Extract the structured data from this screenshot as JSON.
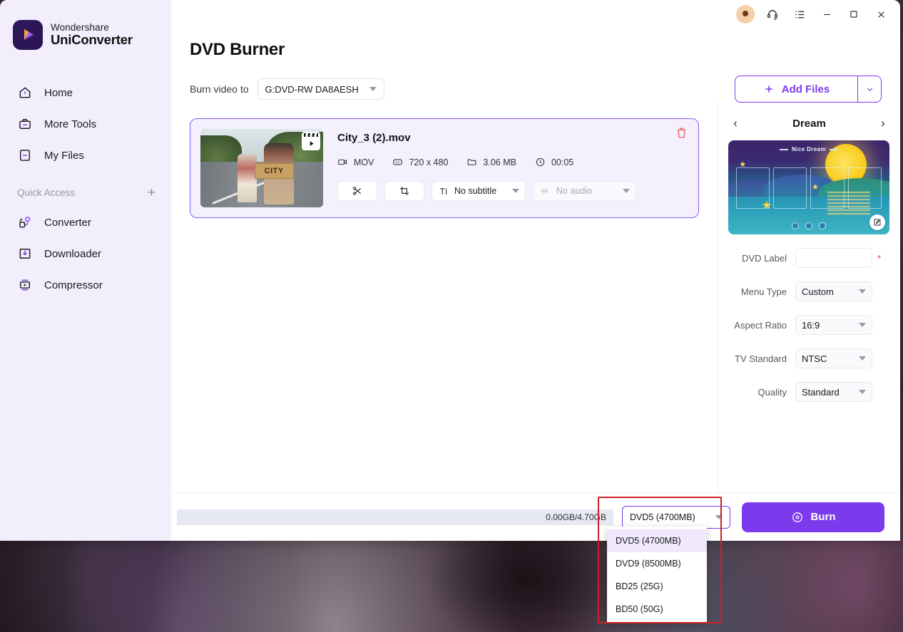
{
  "brand": {
    "top": "Wondershare",
    "bottom": "UniConverter",
    "logo_icon": "play-logo-icon"
  },
  "sidebar": {
    "items": [
      {
        "label": "Home",
        "icon": "home-icon"
      },
      {
        "label": "More Tools",
        "icon": "toolbox-icon"
      },
      {
        "label": "My Files",
        "icon": "files-icon"
      }
    ],
    "quick_access": {
      "label": "Quick Access",
      "add_icon": "plus-icon"
    },
    "quick_items": [
      {
        "label": "Converter",
        "icon": "converter-icon"
      },
      {
        "label": "Downloader",
        "icon": "downloader-icon"
      },
      {
        "label": "Compressor",
        "icon": "compressor-icon"
      }
    ]
  },
  "titlebar": {
    "account_icon": "account-avatar-icon",
    "support_icon": "headset-icon",
    "menu_icon": "list-menu-icon",
    "minimize_icon": "minimize-icon",
    "maximize_icon": "maximize-icon",
    "close_icon": "close-icon"
  },
  "header": {
    "page_title": "DVD Burner",
    "burn_to_label": "Burn video to",
    "drive_value": "G:DVD-RW DA8AESH",
    "add_files_label": "Add Files",
    "add_files_icon": "plus-icon",
    "add_files_caret_icon": "chevron-down-icon"
  },
  "file": {
    "name": "City_3 (2).mov",
    "thumb_sign_text": "CITY",
    "meta": [
      {
        "icon": "video-camera-icon",
        "value": "MOV"
      },
      {
        "icon": "resolution-icon",
        "value": "720 x 480"
      },
      {
        "icon": "folder-icon",
        "value": "3.06 MB"
      },
      {
        "icon": "clock-icon",
        "value": "00:05"
      }
    ],
    "trim_icon": "scissors-icon",
    "crop_icon": "crop-icon",
    "subtitle_icon": "text-tool-icon",
    "subtitle_value": "No subtitle",
    "audio_icon": "audio-wave-icon",
    "audio_value": "No audio",
    "delete_icon": "trash-icon"
  },
  "right_panel": {
    "template_name": "Dream",
    "prev_icon": "chevron-left-icon",
    "next_icon": "chevron-right-icon",
    "preview_title": "Nice Dream",
    "edit_icon": "edit-pencil-icon",
    "fields": [
      {
        "label": "DVD Label",
        "value": "",
        "type": "input",
        "required": true
      },
      {
        "label": "Menu Type",
        "value": "Custom",
        "type": "select",
        "required": false
      },
      {
        "label": "Aspect Ratio",
        "value": "16:9",
        "type": "select",
        "required": false
      },
      {
        "label": "TV Standard",
        "value": "NTSC",
        "type": "select",
        "required": false
      },
      {
        "label": "Quality",
        "value": "Standard",
        "type": "select",
        "required": false
      }
    ]
  },
  "bottom": {
    "capacity_text": "0.00GB/4.70GB",
    "disc_selected": "DVD5 (4700MB)",
    "burn_label": "Burn",
    "burn_icon": "disc-icon",
    "disc_options": [
      "DVD5 (4700MB)",
      "DVD9 (8500MB)",
      "BD25 (25G)",
      "BD50 (50G)"
    ]
  },
  "colors": {
    "accent": "#7c3aed",
    "sidebar_bg": "#f2eefb",
    "card_border": "#8b5cf6",
    "card_bg": "#f4f0fd",
    "annotation": "#cf2026",
    "required": "#e2383f"
  }
}
